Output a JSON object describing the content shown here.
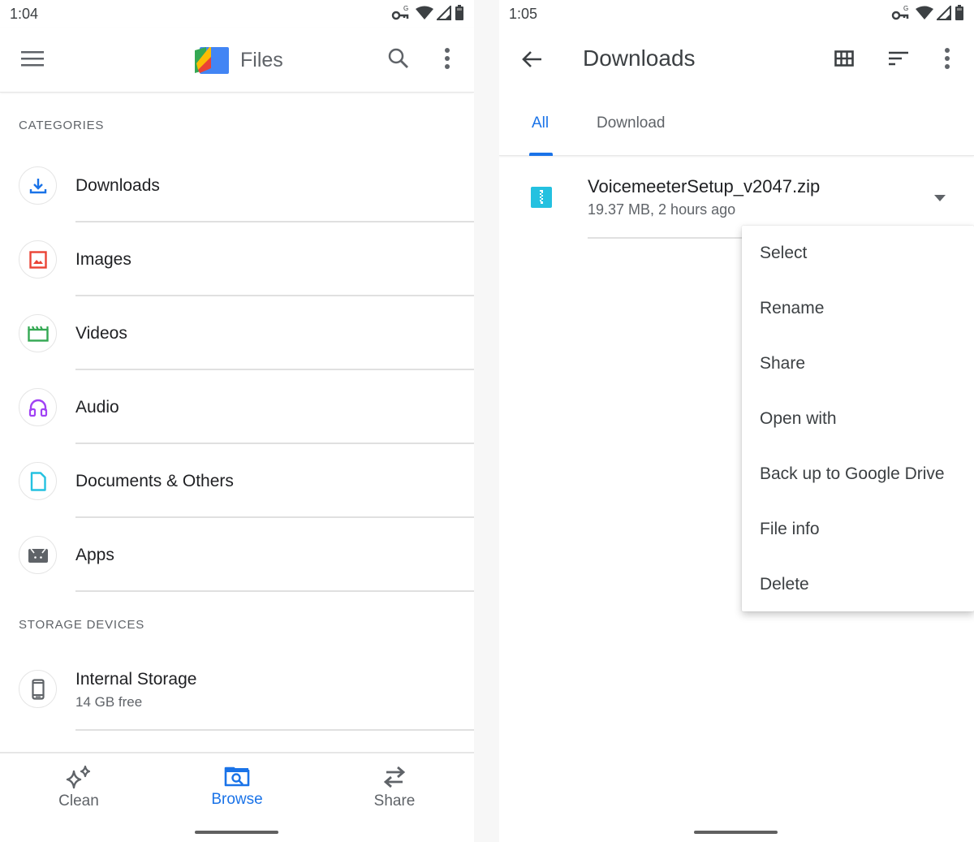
{
  "left_screen": {
    "status": {
      "time": "1:04"
    },
    "appbar": {
      "title": "Files"
    },
    "sections": {
      "categories_header": "CATEGORIES",
      "storage_header": "STORAGE DEVICES"
    },
    "categories": [
      {
        "label": "Downloads",
        "icon": "download-icon",
        "color": "#1a73e8"
      },
      {
        "label": "Images",
        "icon": "image-icon",
        "color": "#ea4335"
      },
      {
        "label": "Videos",
        "icon": "video-clapper-icon",
        "color": "#34a853"
      },
      {
        "label": "Audio",
        "icon": "headphones-icon",
        "color": "#a142f4"
      },
      {
        "label": "Documents & Others",
        "icon": "document-icon",
        "color": "#24c1e0"
      },
      {
        "label": "Apps",
        "icon": "android-icon",
        "color": "#5f6368"
      }
    ],
    "storage": [
      {
        "label": "Internal Storage",
        "sub": "14 GB free",
        "icon": "phone-icon"
      }
    ],
    "bottom_nav": [
      {
        "label": "Clean",
        "icon": "sparkle-icon",
        "active": false
      },
      {
        "label": "Browse",
        "icon": "folder-search-icon",
        "active": true
      },
      {
        "label": "Share",
        "icon": "swap-arrows-icon",
        "active": false
      }
    ]
  },
  "right_screen": {
    "status": {
      "time": "1:05"
    },
    "toolbar": {
      "title": "Downloads"
    },
    "tabs": [
      {
        "label": "All",
        "active": true
      },
      {
        "label": "Download",
        "active": false
      }
    ],
    "file": {
      "name": "VoicemeeterSetup_v2047.zip",
      "meta": "19.37 MB, 2 hours ago",
      "icon": "zip-file-icon",
      "icon_color": "#24c1e0"
    },
    "context_menu": [
      "Select",
      "Rename",
      "Share",
      "Open with",
      "Back up to Google Drive",
      "File info",
      "Delete"
    ]
  },
  "colors": {
    "accent": "#1a73e8",
    "text_primary": "#202124",
    "text_secondary": "#5f6368"
  }
}
